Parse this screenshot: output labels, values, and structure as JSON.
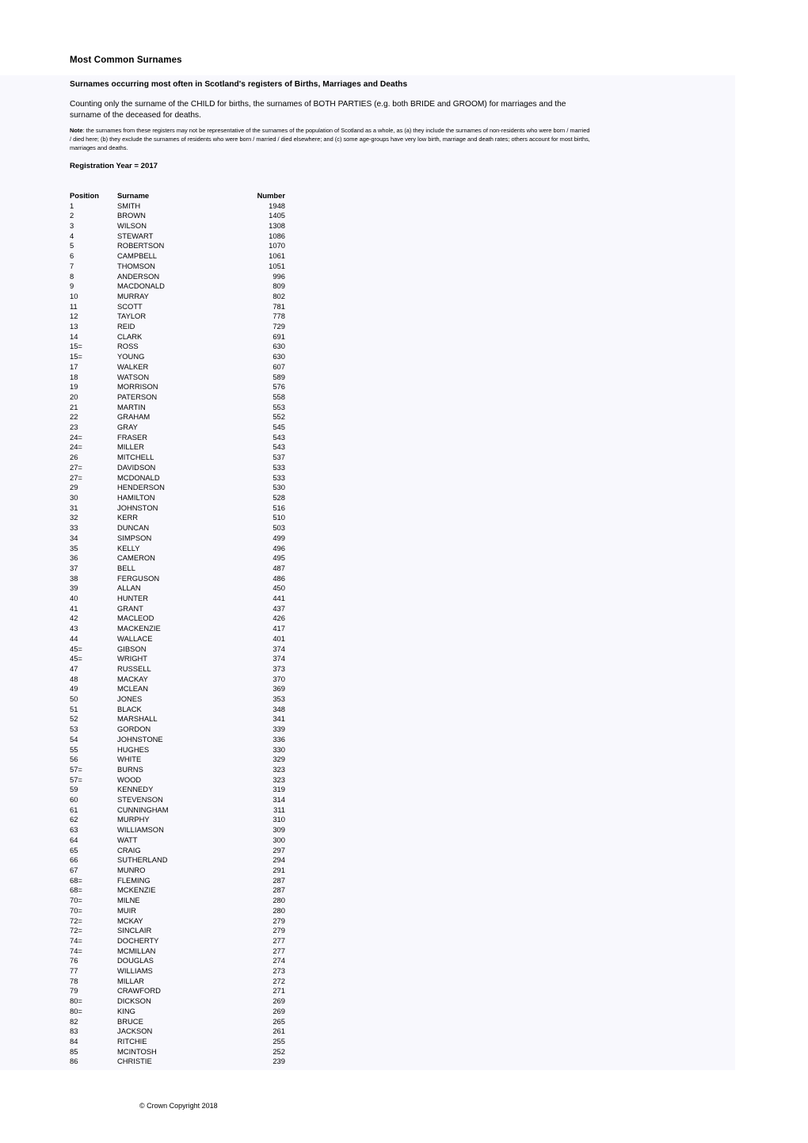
{
  "document": {
    "title": "Most Common Surnames",
    "subtitle": "Surnames occurring most often in Scotland's registers of Births, Marriages and Deaths",
    "intro": "Counting only the surname of the CHILD for births, the surnames of BOTH PARTIES (e.g. both BRIDE and GROOM) for marriages and the surname of the deceased for deaths.",
    "note_label": "Note",
    "note_body": ": the surnames from these registers may not be representative of the surnames of the population of Scotland as a whole, as (a) they include the surnames of non-residents who were born / married / died here; (b) they exclude the surnames of residents who were born / married / died elsewhere; and (c) some age-groups have very low birth, marriage and death rates; others account for most births, marriages and deaths.",
    "registration_year": "Registration Year = 2017",
    "copyright": "© Crown Copyright 2018",
    "tint_color": "#f8f8fd"
  },
  "table": {
    "columns": [
      "Position",
      "Surname",
      "Number"
    ],
    "rows": [
      [
        "1",
        "SMITH",
        "1948"
      ],
      [
        "2",
        "BROWN",
        "1405"
      ],
      [
        "3",
        "WILSON",
        "1308"
      ],
      [
        "4",
        "STEWART",
        "1086"
      ],
      [
        "5",
        "ROBERTSON",
        "1070"
      ],
      [
        "6",
        "CAMPBELL",
        "1061"
      ],
      [
        "7",
        "THOMSON",
        "1051"
      ],
      [
        "8",
        "ANDERSON",
        "996"
      ],
      [
        "9",
        "MACDONALD",
        "809"
      ],
      [
        "10",
        "MURRAY",
        "802"
      ],
      [
        "11",
        "SCOTT",
        "781"
      ],
      [
        "12",
        "TAYLOR",
        "778"
      ],
      [
        "13",
        "REID",
        "729"
      ],
      [
        "14",
        "CLARK",
        "691"
      ],
      [
        "15=",
        "ROSS",
        "630"
      ],
      [
        "15=",
        "YOUNG",
        "630"
      ],
      [
        "17",
        "WALKER",
        "607"
      ],
      [
        "18",
        "WATSON",
        "589"
      ],
      [
        "19",
        "MORRISON",
        "576"
      ],
      [
        "20",
        "PATERSON",
        "558"
      ],
      [
        "21",
        "MARTIN",
        "553"
      ],
      [
        "22",
        "GRAHAM",
        "552"
      ],
      [
        "23",
        "GRAY",
        "545"
      ],
      [
        "24=",
        "FRASER",
        "543"
      ],
      [
        "24=",
        "MILLER",
        "543"
      ],
      [
        "26",
        "MITCHELL",
        "537"
      ],
      [
        "27=",
        "DAVIDSON",
        "533"
      ],
      [
        "27=",
        "MCDONALD",
        "533"
      ],
      [
        "29",
        "HENDERSON",
        "530"
      ],
      [
        "30",
        "HAMILTON",
        "528"
      ],
      [
        "31",
        "JOHNSTON",
        "516"
      ],
      [
        "32",
        "KERR",
        "510"
      ],
      [
        "33",
        "DUNCAN",
        "503"
      ],
      [
        "34",
        "SIMPSON",
        "499"
      ],
      [
        "35",
        "KELLY",
        "496"
      ],
      [
        "36",
        "CAMERON",
        "495"
      ],
      [
        "37",
        "BELL",
        "487"
      ],
      [
        "38",
        "FERGUSON",
        "486"
      ],
      [
        "39",
        "ALLAN",
        "450"
      ],
      [
        "40",
        "HUNTER",
        "441"
      ],
      [
        "41",
        "GRANT",
        "437"
      ],
      [
        "42",
        "MACLEOD",
        "426"
      ],
      [
        "43",
        "MACKENZIE",
        "417"
      ],
      [
        "44",
        "WALLACE",
        "401"
      ],
      [
        "45=",
        "GIBSON",
        "374"
      ],
      [
        "45=",
        "WRIGHT",
        "374"
      ],
      [
        "47",
        "RUSSELL",
        "373"
      ],
      [
        "48",
        "MACKAY",
        "370"
      ],
      [
        "49",
        "MCLEAN",
        "369"
      ],
      [
        "50",
        "JONES",
        "353"
      ],
      [
        "51",
        "BLACK",
        "348"
      ],
      [
        "52",
        "MARSHALL",
        "341"
      ],
      [
        "53",
        "GORDON",
        "339"
      ],
      [
        "54",
        "JOHNSTONE",
        "336"
      ],
      [
        "55",
        "HUGHES",
        "330"
      ],
      [
        "56",
        "WHITE",
        "329"
      ],
      [
        "57=",
        "BURNS",
        "323"
      ],
      [
        "57=",
        "WOOD",
        "323"
      ],
      [
        "59",
        "KENNEDY",
        "319"
      ],
      [
        "60",
        "STEVENSON",
        "314"
      ],
      [
        "61",
        "CUNNINGHAM",
        "311"
      ],
      [
        "62",
        "MURPHY",
        "310"
      ],
      [
        "63",
        "WILLIAMSON",
        "309"
      ],
      [
        "64",
        "WATT",
        "300"
      ],
      [
        "65",
        "CRAIG",
        "297"
      ],
      [
        "66",
        "SUTHERLAND",
        "294"
      ],
      [
        "67",
        "MUNRO",
        "291"
      ],
      [
        "68=",
        "FLEMING",
        "287"
      ],
      [
        "68=",
        "MCKENZIE",
        "287"
      ],
      [
        "70=",
        "MILNE",
        "280"
      ],
      [
        "70=",
        "MUIR",
        "280"
      ],
      [
        "72=",
        "MCKAY",
        "279"
      ],
      [
        "72=",
        "SINCLAIR",
        "279"
      ],
      [
        "74=",
        "DOCHERTY",
        "277"
      ],
      [
        "74=",
        "MCMILLAN",
        "277"
      ],
      [
        "76",
        "DOUGLAS",
        "274"
      ],
      [
        "77",
        "WILLIAMS",
        "273"
      ],
      [
        "78",
        "MILLAR",
        "272"
      ],
      [
        "79",
        "CRAWFORD",
        "271"
      ],
      [
        "80=",
        "DICKSON",
        "269"
      ],
      [
        "80=",
        "KING",
        "269"
      ],
      [
        "82",
        "BRUCE",
        "265"
      ],
      [
        "83",
        "JACKSON",
        "261"
      ],
      [
        "84",
        "RITCHIE",
        "255"
      ],
      [
        "85",
        "MCINTOSH",
        "252"
      ],
      [
        "86",
        "CHRISTIE",
        "239"
      ]
    ]
  }
}
